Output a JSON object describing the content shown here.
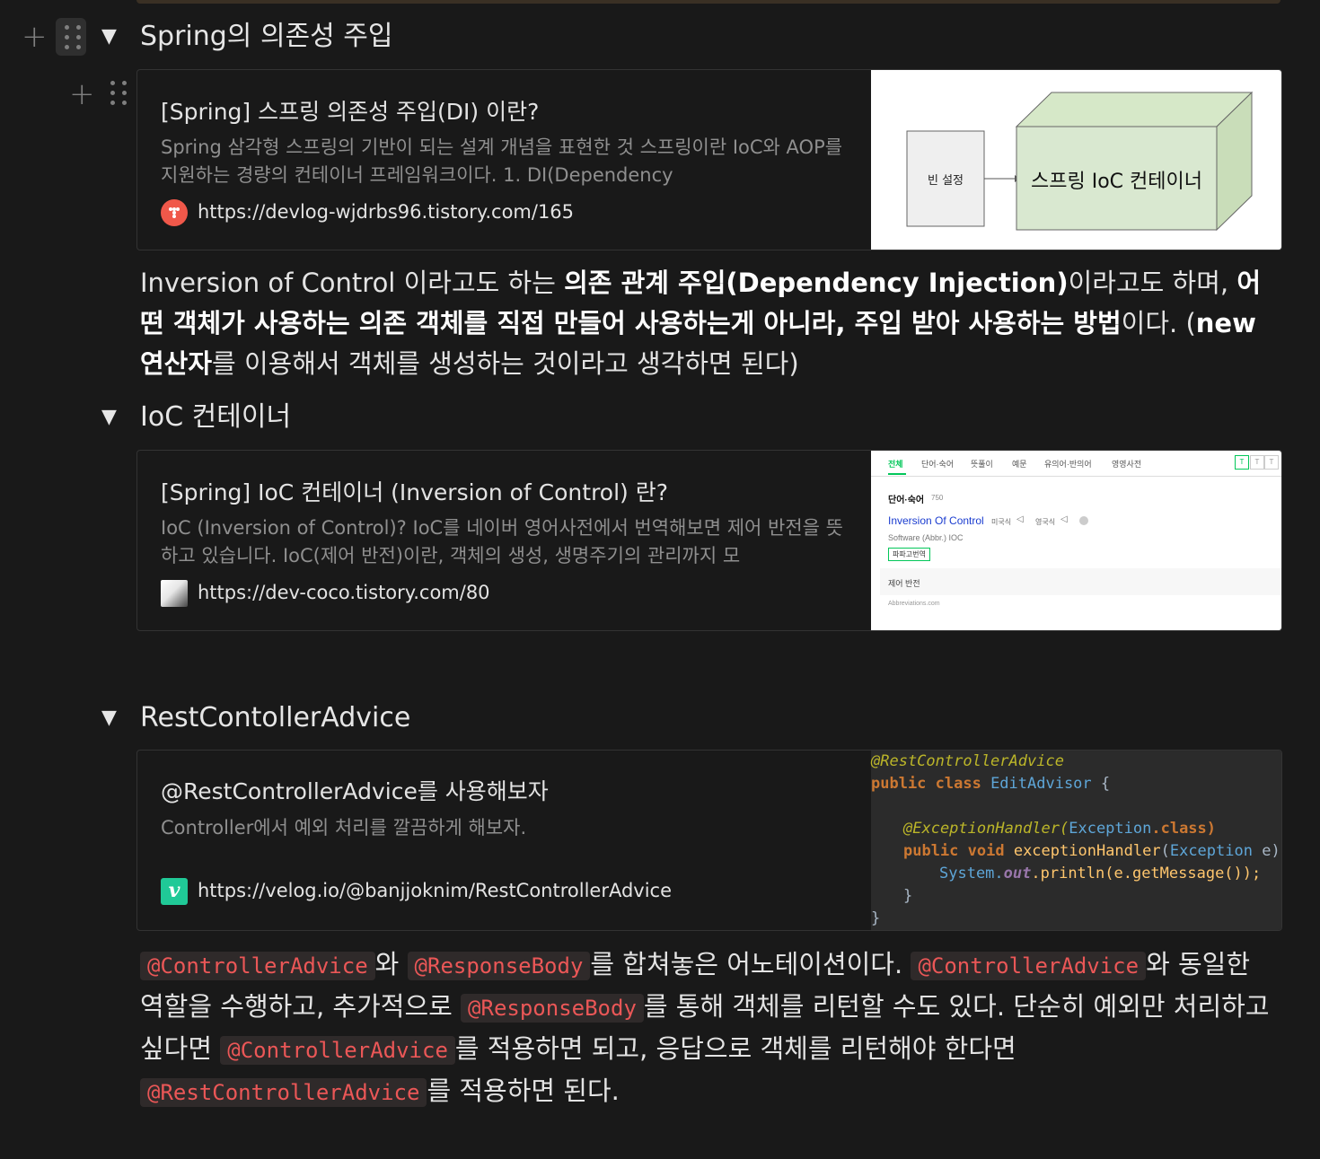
{
  "sections": [
    {
      "heading": "Spring의 의존성 주입",
      "bookmark": {
        "title": "[Spring] 스프링 의존성 주입(DI) 이란?",
        "description": "Spring 삼각형 스프링의 기반이 되는 설계 개념을 표현한 것 스프링이란 IoC와 AOP를 지원하는 경량의 컨테이너 프레임워크이다. 1. DI(Dependency",
        "url": "https://devlog-wjdrbs96.tistory.com/165",
        "thumb": {
          "left_label": "빈 설정",
          "box_label": "스프링 IoC 컨테이너"
        }
      },
      "paragraph": {
        "p1": "Inversion of Control 이라고도 하는 ",
        "b1": "의존 관계 주입(Dependency Injection)",
        "p2": "이라고도 하며, ",
        "b2": "어떤 객체가 사용하는 의존 객체를 직접 만들어 사용하는게 아니라, 주입 받아 사용하는 방법",
        "p3": "이다. (",
        "b3": "new 연산자",
        "p4": "를 이용해서 객체를 생성하는 것이라고 생각하면 된다)"
      }
    },
    {
      "heading": "IoC 컨테이너",
      "bookmark": {
        "title": "[Spring] IoC 컨테이너 (Inversion of Control) 란?",
        "description": "IoC (Inversion of Control)? IoC를 네이버 영어사전에서 번역해보면 제어 반전을 뜻하고 있습니다. IoC(제어 반전)이란, 객체의 생성, 생명주기의 관리까지 모",
        "url": "https://dev-coco.tistory.com/80",
        "thumb": {
          "tabs": [
            "전체",
            "단어·숙어",
            "뜻풀이",
            "예문",
            "유의어·반의어",
            "영영사전"
          ],
          "font_toggles": [
            "T",
            "T",
            "T"
          ],
          "section_title": "단어·숙어",
          "count": "750",
          "term": "Inversion Of Control",
          "pron1": "미국식",
          "pron2": "영국식",
          "sub": "Software (Abbr.) IOC",
          "papago": "파파고번역",
          "meaning": "제어 반전",
          "source": "Abbreviations.com"
        }
      }
    },
    {
      "heading": "RestContollerAdvice",
      "bookmark": {
        "title": "@RestControllerAdvice를 사용해보자",
        "description": "Controller에서 예외 처리를 깔끔하게 해보자.",
        "url": "https://velog.io/@banjjoknim/RestControllerAdvice",
        "favicon_letter": "v",
        "thumb": {
          "l1": "@RestControllerAdvice",
          "l2a": "public class ",
          "l2b": "EditAdvisor",
          "l2c": " {",
          "l3a": "@ExceptionHandler(",
          "l3b": "Exception",
          "l3c": ".class)",
          "l4a": "public void ",
          "l4b": "exceptionHandler",
          "l4c": "(",
          "l4d": "Exception",
          "l4e": " e) {",
          "l5a": "System.",
          "l5b": "out",
          "l5c": ".println(e.getMessage());",
          "l6": "}",
          "l7": "}"
        }
      },
      "paragraph": {
        "c1": "@ControllerAdvice",
        "t1": "와 ",
        "c2": "@ResponseBody",
        "t2": "를 합쳐놓은 어노테이션이다. ",
        "c3": "@ControllerAdvice",
        "t3": "와 동일한 역할을 수행하고, 추가적으로 ",
        "c4": "@ResponseBody",
        "t4": "를 통해 객체를 리턴할 수도 있다. 단순히 예외만 처리하고 싶다면 ",
        "c5": "@ControllerAdvice",
        "t5": "를 적용하면 되고, 응답으로 객체를 리턴해야 한다면 ",
        "c6": "@RestControllerAdvice",
        "t6": "를 적용하면 된다."
      }
    }
  ],
  "colors": {
    "background": "#191919",
    "code_red": "#eb5757",
    "thumb_green": "#d9e8d0",
    "naver_green": "#03c75a"
  },
  "icons": [
    "plus-icon",
    "drag-handle-icon",
    "toggle-triangle-icon",
    "tistory-favicon",
    "velog-favicon"
  ]
}
